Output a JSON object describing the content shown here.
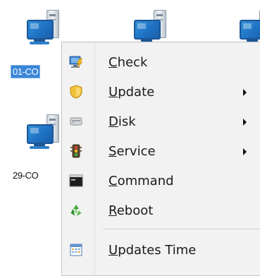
{
  "desktop": {
    "icons": [
      {
        "label": "01-CO",
        "selected": true,
        "icon": "computer-icon"
      },
      {
        "label": "",
        "selected": false,
        "icon": "computer-icon"
      },
      {
        "label": "",
        "selected": false,
        "icon": "computer-icon"
      },
      {
        "label": "29-CO",
        "selected": false,
        "icon": "computer-icon"
      }
    ]
  },
  "context_menu": {
    "items": [
      {
        "mnemonic": "C",
        "rest": "heck",
        "icon": "monitor-lightning-icon",
        "submenu": false
      },
      {
        "mnemonic": "U",
        "rest": "pdate",
        "icon": "shield-icon",
        "submenu": true
      },
      {
        "mnemonic": "D",
        "rest": "isk",
        "icon": "disk-drive-icon",
        "submenu": true
      },
      {
        "mnemonic": "S",
        "rest": "ervice",
        "icon": "traffic-light-icon",
        "submenu": true
      },
      {
        "mnemonic": "C",
        "rest": "ommand",
        "icon": "console-icon",
        "submenu": false
      },
      {
        "mnemonic": "R",
        "rest": "eboot",
        "icon": "recycle-icon",
        "submenu": false
      },
      {
        "mnemonic": "U",
        "rest": "pdates Time",
        "icon": "calendar-icon",
        "submenu": false
      }
    ]
  },
  "colors": {
    "selection": "#3a86d8",
    "menu_background": "#f2f2f2"
  }
}
